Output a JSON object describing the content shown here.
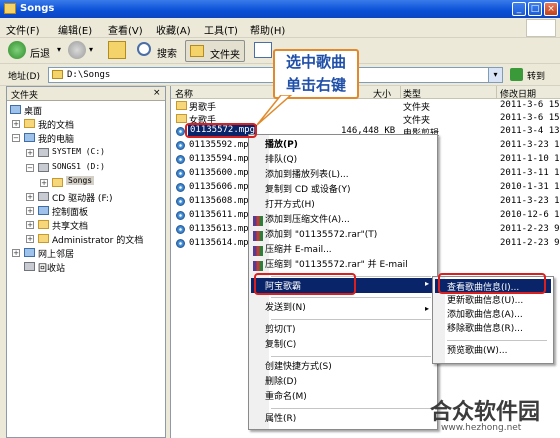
{
  "window": {
    "title": "Songs"
  },
  "menubar": [
    "文件(F)",
    "编辑(E)",
    "查看(V)",
    "收藏(A)",
    "工具(T)",
    "帮助(H)"
  ],
  "toolbar": {
    "back": "后退",
    "search": "搜索",
    "folders": "文件夹"
  },
  "address": {
    "label": "地址(D)",
    "value": "D:\\Songs",
    "go": "转到"
  },
  "folders_pane": {
    "title": "文件夹",
    "tree": [
      "桌面",
      "我的文档",
      "我的电脑",
      "SYSTEM (C:)",
      "SONGS1 (D:)",
      "Songs",
      "CD 驱动器 (F:)",
      "控制面板",
      "共享文档",
      "Administrator 的文档",
      "网上邻居",
      "回收站"
    ]
  },
  "file_list": {
    "columns": [
      "名称",
      "大小",
      "类型",
      "修改日期"
    ],
    "rows": [
      {
        "name": "男歌手",
        "size": "",
        "type": "文件夹",
        "date": "2011-3-6 15"
      },
      {
        "name": "女歌手",
        "size": "",
        "type": "文件夹",
        "date": "2011-3-6 15"
      },
      {
        "name": "01135572.mpg",
        "size": "146,448 KB",
        "type": "电影剪辑",
        "date": "2011-3-4 13"
      },
      {
        "name": "01135592.mpg",
        "size": "",
        "type": "",
        "date": "2011-3-23 15"
      },
      {
        "name": "01135594.mpg",
        "size": "",
        "type": "",
        "date": "2011-1-10 13"
      },
      {
        "name": "01135600.mpg",
        "size": "",
        "type": "",
        "date": "2011-3-11 12"
      },
      {
        "name": "01135606.mpg",
        "size": "",
        "type": "",
        "date": "2010-1-31 10"
      },
      {
        "name": "01135608.mpg",
        "size": "",
        "type": "",
        "date": "2011-3-23 10"
      },
      {
        "name": "01135611.mpg",
        "size": "",
        "type": "",
        "date": "2010-12-6 12"
      },
      {
        "name": "01135613.mpg",
        "size": "",
        "type": "",
        "date": "2011-2-23 9"
      },
      {
        "name": "01135614.mpg",
        "size": "",
        "type": "",
        "date": "2011-2-23 9"
      }
    ]
  },
  "context_menu": [
    {
      "label": "播放(P)",
      "bold": true
    },
    {
      "label": "排队(Q)"
    },
    {
      "label": "添加到播放列表(L)..."
    },
    {
      "label": "复制到 CD 或设备(Y)"
    },
    {
      "label": "打开方式(H)"
    },
    {
      "label": "添加到压缩文件(A)..."
    },
    {
      "label": "添加到 \"01135572.rar\"(T)"
    },
    {
      "label": "压缩并 E-mail..."
    },
    {
      "label": "压缩到 \"01135572.rar\" 并 E-mail"
    },
    {
      "label": "阿宝歌霸"
    },
    {
      "label": "发送到(N)"
    },
    {
      "label": "剪切(T)"
    },
    {
      "label": "复制(C)"
    },
    {
      "label": "创建快捷方式(S)"
    },
    {
      "label": "删除(D)"
    },
    {
      "label": "重命名(M)"
    },
    {
      "label": "属性(R)"
    }
  ],
  "submenu": [
    "查看歌曲信息(I)...",
    "更新歌曲信息(U)...",
    "添加歌曲信息(A)...",
    "移除歌曲信息(R)...",
    "预览歌曲(W)..."
  ],
  "annotation": {
    "line1": "选中歌曲",
    "line2": "单击右键"
  },
  "watermark": {
    "text": "合众软件园",
    "url": "www.hezhong.net"
  },
  "colors": {
    "selection": "#0A246A",
    "highlight_box": "#D82020",
    "callout_border": "#E08A2B",
    "callout_text": "#1F4FA8"
  }
}
